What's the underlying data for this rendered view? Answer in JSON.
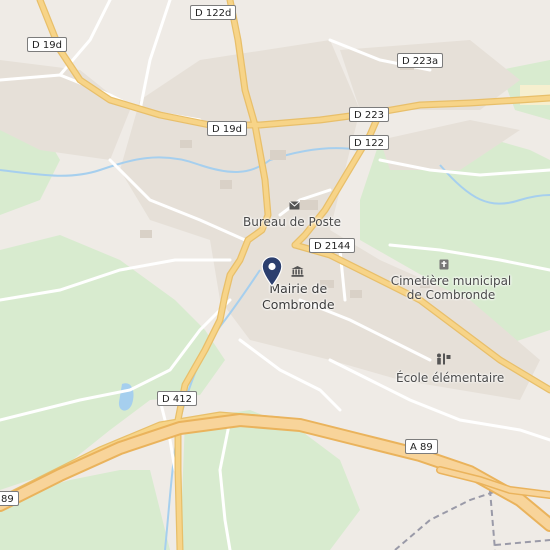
{
  "map": {
    "colors": {
      "land": "#efebe6",
      "green": "#d8ebcf",
      "residential": "#e6e0d8",
      "water": "#a6cfee",
      "major_road": "#f7d488",
      "minor_road": "#ffffff",
      "pin": "#2c3f6e"
    },
    "road_labels": [
      {
        "id": "d122d",
        "text": "D 122d"
      },
      {
        "id": "d19d-a",
        "text": "D 19d"
      },
      {
        "id": "d223a",
        "text": "D 223a"
      },
      {
        "id": "d223",
        "text": "D 223"
      },
      {
        "id": "d19d-b",
        "text": "D 19d"
      },
      {
        "id": "d122",
        "text": "D 122"
      },
      {
        "id": "d2144",
        "text": "D 2144"
      },
      {
        "id": "d412",
        "text": "D 412"
      },
      {
        "id": "a89-a",
        "text": "A 89"
      },
      {
        "id": "a89-b",
        "text": "89"
      }
    ],
    "places": {
      "post_office": {
        "label": "Bureau de Poste",
        "icon": "envelope-icon"
      },
      "town_hall": {
        "label_line1": "Mairie de",
        "label_line2": "Combronde",
        "icon": "town-hall-icon"
      },
      "cemetery": {
        "label_line1": "Cimetière municipal",
        "label_line2": "de Combronde",
        "icon": "cemetery-icon"
      },
      "school": {
        "label": "École élémentaire",
        "icon": "school-icon"
      }
    },
    "marker": {
      "icon": "location-pin-icon"
    }
  }
}
